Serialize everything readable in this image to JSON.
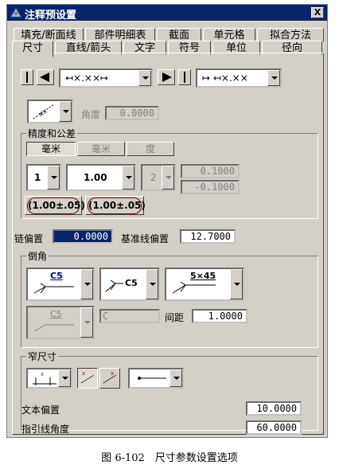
{
  "window": {
    "title": "注释预设置",
    "close_label": "X"
  },
  "tabs_row1": [
    "填充/断面线",
    "部件明细表",
    "截面",
    "单元格",
    "拟合方法"
  ],
  "tabs_row2": [
    "尺寸",
    "直线/箭头",
    "文字",
    "符号",
    "单位",
    "径向"
  ],
  "dimension": {
    "left_combo_value": "↤×.××↦",
    "right_combo_value": "↦ ↤×.××",
    "angle_label": "角度",
    "angle_value": "0.0000"
  },
  "precision": {
    "group_title": "精度和公差",
    "unit_buttons": [
      "毫米",
      "毫米",
      "度"
    ],
    "precision_value": "1",
    "tolerance_type_value": "1.00",
    "tolerance_precision_value": "2",
    "upper_tolerance": "0.1000",
    "lower_tolerance": "-0.1000",
    "preset_a": "(1.00±.05)",
    "preset_b": "(1.00±.05)"
  },
  "offsets": {
    "chain_label": "链偏置",
    "chain_value": "0.0000",
    "baseline_label": "基准线偏置",
    "baseline_value": "12.7000"
  },
  "chamfer": {
    "group_title": "倒角",
    "style_a": "C5",
    "style_b": "C5",
    "style_c": "5×45",
    "disabled_style": "C5",
    "disabled_field": "C",
    "spacing_label": "间距",
    "spacing_value": "1.0000"
  },
  "narrow": {
    "group_title": "窄尺寸",
    "text_offset_label": "文本偏置",
    "text_offset_value": "10.0000",
    "leader_angle_label": "指引线角度",
    "leader_angle_value": "60.0000"
  },
  "caption": "图 6-102　尺寸参数设置选项"
}
